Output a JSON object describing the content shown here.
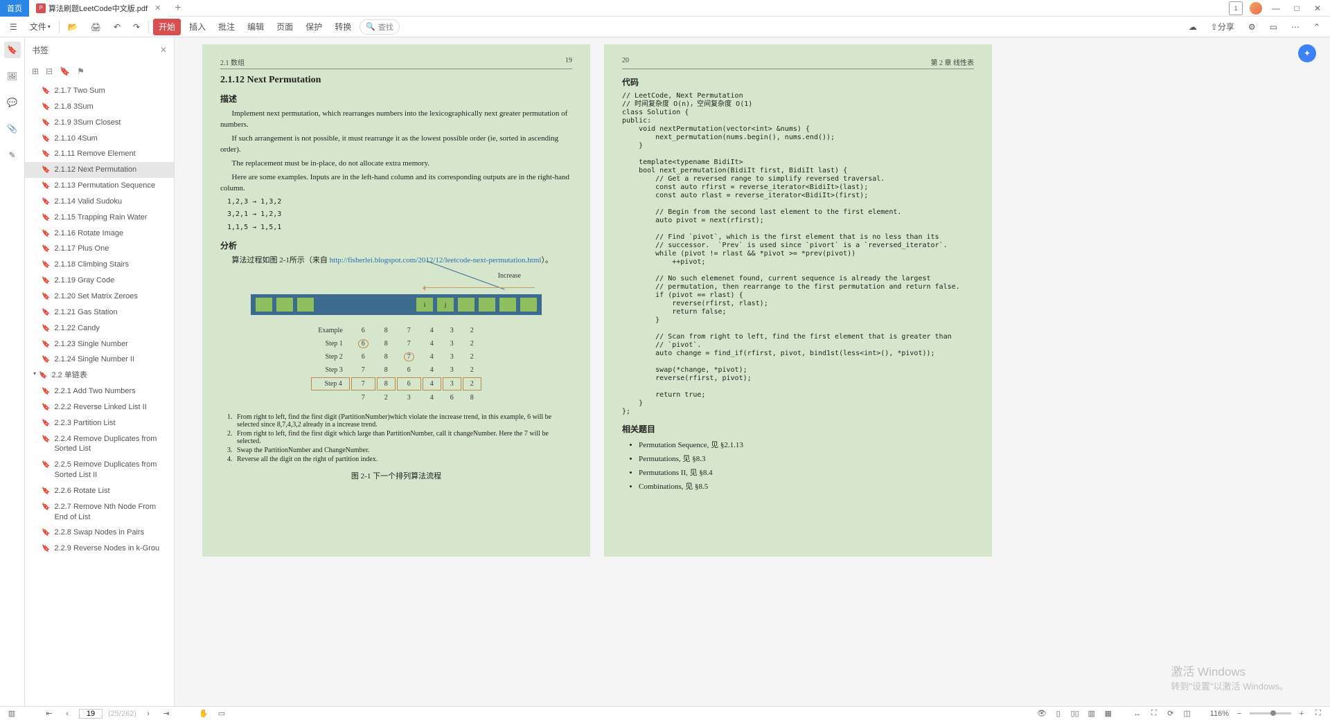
{
  "tabs": {
    "home": "首页",
    "file": "算法刷题LeetCode中文版.pdf"
  },
  "menu": {
    "file": "文件",
    "start": "开始",
    "insert": "插入",
    "annotate": "批注",
    "edit": "编辑",
    "page": "页面",
    "protect": "保护",
    "convert": "转换",
    "search": "查找",
    "share": "分享"
  },
  "bookmarks": {
    "title": "书签",
    "items": [
      {
        "l": "2.1.7 Two Sum",
        "d": 1
      },
      {
        "l": "2.1.8 3Sum",
        "d": 1
      },
      {
        "l": "2.1.9 3Sum Closest",
        "d": 1
      },
      {
        "l": "2.1.10 4Sum",
        "d": 1
      },
      {
        "l": "2.1.11 Remove Element",
        "d": 1
      },
      {
        "l": "2.1.12 Next Permutation",
        "d": 1,
        "active": true
      },
      {
        "l": "2.1.13 Permutation Sequence",
        "d": 1
      },
      {
        "l": "2.1.14 Valid Sudoku",
        "d": 1
      },
      {
        "l": "2.1.15 Trapping Rain Water",
        "d": 1
      },
      {
        "l": "2.1.16 Rotate Image",
        "d": 1
      },
      {
        "l": "2.1.17 Plus One",
        "d": 1
      },
      {
        "l": "2.1.18 Climbing Stairs",
        "d": 1
      },
      {
        "l": "2.1.19 Gray Code",
        "d": 1
      },
      {
        "l": "2.1.20 Set Matrix Zeroes",
        "d": 1
      },
      {
        "l": "2.1.21 Gas Station",
        "d": 1
      },
      {
        "l": "2.1.22 Candy",
        "d": 1
      },
      {
        "l": "2.1.23 Single Number",
        "d": 1
      },
      {
        "l": "2.1.24 Single Number II",
        "d": 1
      },
      {
        "l": "2.2 单链表",
        "d": 0,
        "section": true
      },
      {
        "l": "2.2.1 Add Two Numbers",
        "d": 1
      },
      {
        "l": "2.2.2 Reverse Linked List II",
        "d": 1
      },
      {
        "l": "2.2.3 Partition List",
        "d": 1
      },
      {
        "l": "2.2.4 Remove Duplicates from Sorted List",
        "d": 1
      },
      {
        "l": "2.2.5 Remove Duplicates from Sorted List II",
        "d": 1
      },
      {
        "l": "2.2.6 Rotate List",
        "d": 1
      },
      {
        "l": "2.2.7 Remove Nth Node From End of List",
        "d": 1
      },
      {
        "l": "2.2.8 Swap Nodes in Pairs",
        "d": 1
      },
      {
        "l": "2.2.9 Reverse Nodes in k-Grou",
        "d": 1
      }
    ]
  },
  "page_left": {
    "hdr_l": "2.1   数组",
    "hdr_r": "19",
    "h3": "2.1.12   Next Permutation",
    "h4a": "描述",
    "p1": "Implement next permutation, which rearranges numbers into the lexicographically next greater permutation of numbers.",
    "p2": "If such arrangement is not possible, it must rearrange it as the lowest possible order (ie, sorted in ascending order).",
    "p3": "The replacement must be in-place, do not allocate extra memory.",
    "p4": "Here are some examples.  Inputs are in the left-hand column and its corresponding outputs are in the right-hand column.",
    "ex1": "1,2,3 → 1,3,2",
    "ex2": "3,2,1 → 1,2,3",
    "ex3": "1,1,5 → 1,5,1",
    "h4b": "分析",
    "p5a": "算法过程如图 2-1所示（来自 ",
    "p5link": "http://fisherlei.blogspot.com/2012/12/leetcode-next-permutation.html",
    "p5b": "）。",
    "increase": "Increase",
    "table": {
      "rows": [
        [
          "Example",
          "6",
          "8",
          "7",
          "4",
          "3",
          "2"
        ],
        [
          "Step 1",
          "6",
          "8",
          "7",
          "4",
          "3",
          "2"
        ],
        [
          "Step 2",
          "6",
          "8",
          "7",
          "4",
          "3",
          "2"
        ],
        [
          "Step 3",
          "7",
          "8",
          "6",
          "4",
          "3",
          "2"
        ],
        [
          "Step 4",
          "7",
          "8",
          "6",
          "4",
          "3",
          "2"
        ],
        [
          "",
          "7",
          "2",
          "3",
          "4",
          "6",
          "8"
        ]
      ]
    },
    "list": [
      "From right to left, find the first digit (PartitionNumber)which violate the increase trend, in this example, 6 will be selected since 8,7,4,3,2 already in a increase trend.",
      "From right to left, find the first digit which large than PartitionNumber, call it changeNumber. Here the 7 will be selected.",
      "Swap the PartitionNumber and ChangeNumber.",
      "Reverse all the digit on the right of partition index."
    ],
    "figcap": "图 2-1   下一个排列算法流程"
  },
  "page_right": {
    "hdr_l": "20",
    "hdr_r": "第 2 章   线性表",
    "h4a": "代码",
    "code": "// LeetCode, Next Permutation\n// 时间复杂度 O(n)，空间复杂度 O(1)\nclass Solution {\npublic:\n    void nextPermutation(vector<int> &nums) {\n        next_permutation(nums.begin(), nums.end());\n    }\n\n    template<typename BidiIt>\n    bool next_permutation(BidiIt first, BidiIt last) {\n        // Get a reversed range to simplify reversed traversal.\n        const auto rfirst = reverse_iterator<BidiIt>(last);\n        const auto rlast = reverse_iterator<BidiIt>(first);\n\n        // Begin from the second last element to the first element.\n        auto pivot = next(rfirst);\n\n        // Find `pivot`, which is the first element that is no less than its\n        // successor.  `Prev` is used since `pivort` is a `reversed_iterator`.\n        while (pivot != rlast && *pivot >= *prev(pivot))\n            ++pivot;\n\n        // No such elemenet found, current sequence is already the largest\n        // permutation, then rearrange to the first permutation and return false.\n        if (pivot == rlast) {\n            reverse(rfirst, rlast);\n            return false;\n        }\n\n        // Scan from right to left, find the first element that is greater than\n        // `pivot`.\n        auto change = find_if(rfirst, pivot, bind1st(less<int>(), *pivot));\n\n        swap(*change, *pivot);\n        reverse(rfirst, pivot);\n\n        return true;\n    }\n};",
    "h4b": "相关题目",
    "rel": [
      "Permutation Sequence, 见 §2.1.13",
      "Permutations, 见 §8.3",
      "Permutations II, 见 §8.4",
      "Combinations, 见 §8.5"
    ]
  },
  "status": {
    "page": "19",
    "total": "(25/262)",
    "zoom": "116%"
  },
  "watermark": {
    "l1": "激活 Windows",
    "l2": "转到\"设置\"以激活 Windows。"
  },
  "badge": "1"
}
